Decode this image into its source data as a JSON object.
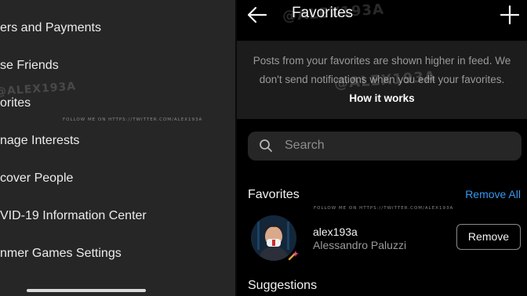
{
  "left_menu": {
    "items": [
      "ers and Payments",
      "se Friends",
      "orites",
      "nage Interests",
      "cover People",
      "VID-19 Information Center",
      "nmer Games Settings"
    ]
  },
  "watermark": {
    "follow_text": "FOLLOW ME ON HTTPS://TWITTER.COM/ALEX193A",
    "handle": "@ALEX193A"
  },
  "header": {
    "title": "Favorites",
    "back_icon": "arrow-left-icon",
    "add_icon": "plus-icon"
  },
  "info": {
    "text": "Posts from your favorites are shown higher in feed. We don't send notifications when you edit your favorites.",
    "link": "How it works"
  },
  "search": {
    "placeholder": "Search",
    "icon": "search-icon"
  },
  "favorites": {
    "heading": "Favorites",
    "remove_all": "Remove All",
    "users": [
      {
        "username": "alex193a",
        "full_name": "Alessandro Paluzzi",
        "action": "Remove"
      }
    ]
  },
  "suggestions": {
    "heading": "Suggestions"
  },
  "colors": {
    "accent": "#3797f0",
    "left_bg": "#262626",
    "info_bg": "#1c1c1c"
  }
}
